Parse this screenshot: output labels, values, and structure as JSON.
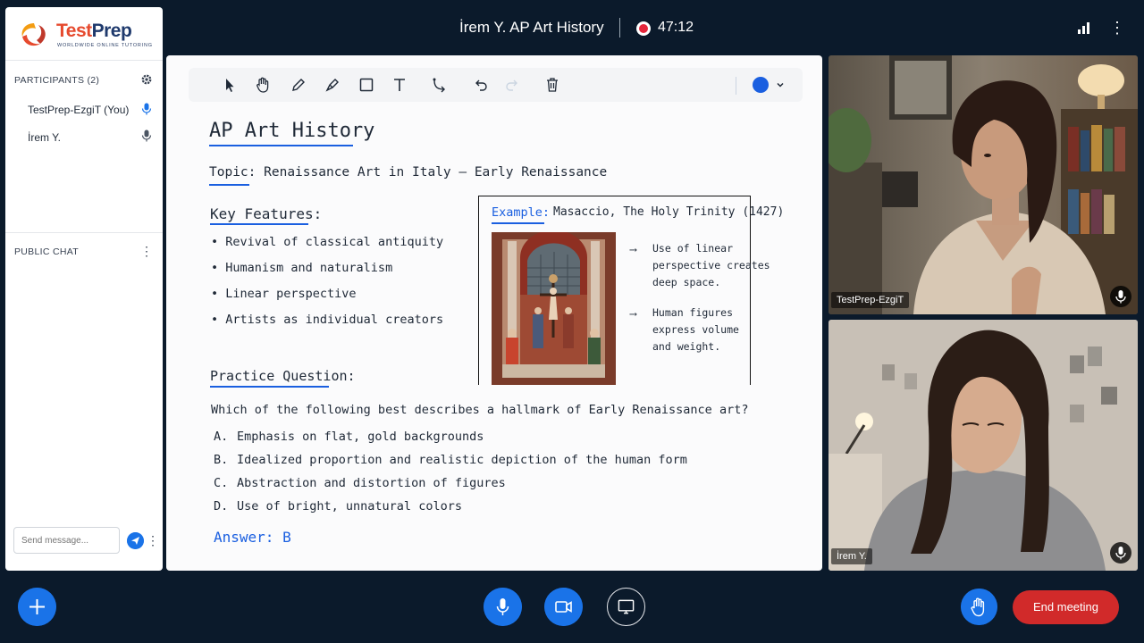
{
  "meeting": {
    "title": "İrem Y. AP Art History",
    "timer": "47:12"
  },
  "brand": {
    "name_part1": "Test",
    "name_part2": "Prep",
    "tagline": "WORLDWIDE ONLINE TUTORING"
  },
  "participants": {
    "header": "PARTICIPANTS  (2)",
    "items": [
      {
        "name": "TestPrep-EzgiT (You)",
        "mic": "mic-active"
      },
      {
        "name": "İrem Y.",
        "mic": "mic"
      }
    ]
  },
  "chat": {
    "header": "PUBLIC CHAT",
    "placeholder": "Send message..."
  },
  "whiteboard": {
    "title": "AP Art History",
    "topic_label": "Topic:",
    "topic_text": "Renaissance Art in Italy – Early Renaissance",
    "key_features_head": "Key Features:",
    "features": [
      "• Revival of classical antiquity",
      "• Humanism and naturalism",
      "• Linear perspective",
      "• Artists as individual creators"
    ],
    "example_label": "Example:",
    "example_text": "Masaccio, The Holy Trinity (1427)",
    "notes": [
      {
        "arrow": "⟶",
        "lines": [
          "Use of linear",
          "perspective creates",
          "deep space."
        ]
      },
      {
        "arrow": "⟶",
        "lines": [
          "Human figures",
          "express volume",
          "and weight."
        ]
      }
    ],
    "practice_head": "Practice Question:",
    "question": "Which of the following best describes a hallmark of Early Renaissance art?",
    "options": [
      {
        "letter": "A.",
        "text": "Emphasis on flat, gold backgrounds"
      },
      {
        "letter": "B.",
        "text": "Idealized proportion and realistic depiction of the human form"
      },
      {
        "letter": "C.",
        "text": "Abstraction and distortion of figures"
      },
      {
        "letter": "D.",
        "text": "Use of bright, unnatural colors"
      }
    ],
    "answer": "Answer: B",
    "pen_color": "#1a5fe0"
  },
  "videos": [
    {
      "name": "TestPrep-EzgiT"
    },
    {
      "name": "İrem Y."
    }
  ],
  "controls": {
    "end_label": "End meeting"
  },
  "colors": {
    "accent": "#1a73e8",
    "danger": "#d12a2a",
    "background": "#0b1a2b"
  }
}
